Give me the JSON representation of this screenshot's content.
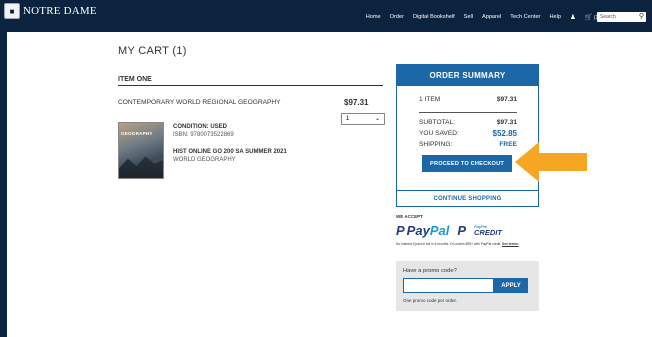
{
  "header": {
    "logo_text": "NOTRE DAME",
    "nav": [
      "Home",
      "Order",
      "Digital Bookshelf",
      "Sell",
      "Apparel",
      "Tech Center",
      "Help"
    ],
    "cart_count": "(1)",
    "search_placeholder": "Search"
  },
  "cart": {
    "title": "MY CART (1)",
    "item_heading": "ITEM ONE",
    "item": {
      "name": "CONTEMPORARY WORLD REGIONAL GEOGRAPHY",
      "price": "$97.31",
      "quantity": "1",
      "cover_label": "GEOGRAPHY",
      "condition": "CONDITION: USED",
      "isbn": "ISBN: 9780073522869",
      "course": "HIST ONLINE GO 200 SA SUMMER 2021",
      "course_sub": "WORLD GEOGRAPHY"
    }
  },
  "summary": {
    "heading": "ORDER SUMMARY",
    "items_label": "1 ITEM",
    "items_value": "$97.31",
    "subtotal_label": "SUBTOTAL:",
    "subtotal_value": "$97.31",
    "saved_label": "YOU SAVED:",
    "saved_value": "$52.85",
    "shipping_label": "SHIPPING:",
    "shipping_value": "FREE",
    "checkout_label": "PROCEED TO CHECKOUT"
  },
  "continue_label": "CONTINUE SHOPPING",
  "payment": {
    "we_accept": "WE ACCEPT",
    "paypal_a": "Pay",
    "paypal_b": "Pal",
    "credit_small": "PayPal",
    "credit_word": "CREDIT",
    "fineprint": "No interest if paid in full in 6 months. On orders $99+ with PayPal credit.",
    "fineprint_link": "See terms."
  },
  "promo": {
    "label": "Have a promo code?",
    "apply_label": "APPLY",
    "note": "One promo code per order."
  },
  "colors": {
    "navy": "#0c2340",
    "blue": "#1b67a8",
    "arrow": "#f5a623"
  }
}
